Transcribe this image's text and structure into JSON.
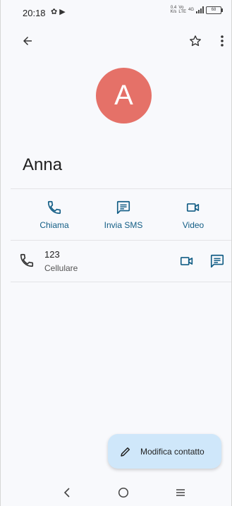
{
  "status_bar": {
    "time": "20:18",
    "left_icons": "✿ ▶",
    "net_speed_value": "0.4",
    "net_speed_unit": "K/s",
    "net_type_top": "Vo",
    "net_type_bottom": "LTE",
    "sig_label": "4G",
    "battery": "68"
  },
  "toolbar": {
    "back_icon": "arrow-left-icon",
    "favorite_icon": "star-outline-icon",
    "more_icon": "more-vert-icon"
  },
  "contact": {
    "initial": "A",
    "name": "Anna",
    "avatar_color": "#e57168"
  },
  "actions": [
    {
      "label": "Chiama",
      "icon": "phone-icon"
    },
    {
      "label": "Invia SMS",
      "icon": "message-icon"
    },
    {
      "label": "Video",
      "icon": "videocam-icon"
    }
  ],
  "phone_entry": {
    "number": "123",
    "type": "Cellulare"
  },
  "fab": {
    "label": "Modifica contatto",
    "icon": "edit-pencil-icon"
  },
  "colors": {
    "accent": "#125d85",
    "fab_background": "#cfe7fa",
    "background": "#f8f9fc"
  }
}
